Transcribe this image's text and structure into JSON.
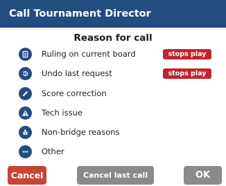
{
  "dialog": {
    "title": "Call Tournament Director",
    "heading": "Reason for call"
  },
  "reasons": [
    {
      "label": "Ruling on current board",
      "icon": "document-icon",
      "badge": "stops play"
    },
    {
      "label": "Undo last request",
      "icon": "undo-icon",
      "badge": "stops play"
    },
    {
      "label": "Score correction",
      "icon": "pencil-icon",
      "badge": ""
    },
    {
      "label": "Tech issue",
      "icon": "warning-icon",
      "badge": ""
    },
    {
      "label": "Non-bridge reasons",
      "icon": "bug-icon",
      "badge": ""
    },
    {
      "label": "Other",
      "icon": "more-icon",
      "badge": ""
    }
  ],
  "buttons": {
    "cancel": "Cancel",
    "cancel_last": "Cancel last call",
    "ok": "OK"
  },
  "colors": {
    "titlebar": "#234c7f",
    "icon": "#234c7f",
    "badge": "#c1252d",
    "cancel_button": "#c74535",
    "neutral_button": "#8a8a8a"
  }
}
